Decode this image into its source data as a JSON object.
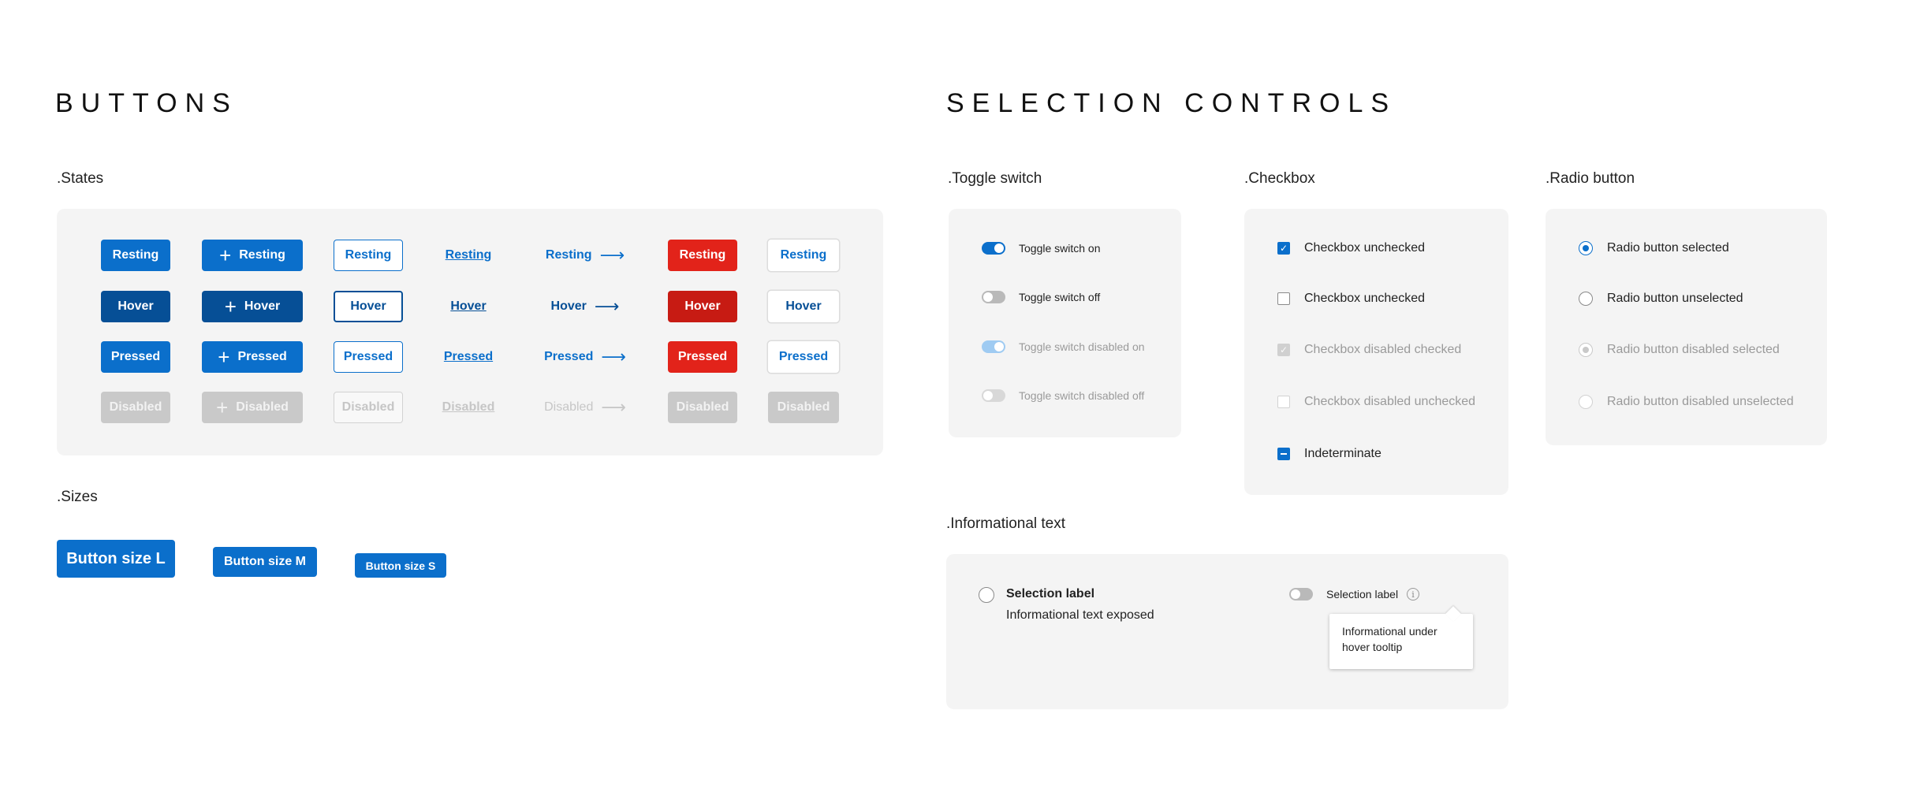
{
  "buttons": {
    "title": "BUTTONS",
    "states_title": ".States",
    "sizes_title": ".Sizes",
    "rows": [
      {
        "primary": "Resting",
        "icon": "Resting",
        "outline": "Resting",
        "link": "Resting",
        "arrow": "Resting",
        "danger": "Resting",
        "ghost": "Resting"
      },
      {
        "primary": "Hover",
        "icon": "Hover",
        "outline": "Hover",
        "link": "Hover",
        "arrow": "Hover",
        "danger": "Hover",
        "ghost": "Hover"
      },
      {
        "primary": "Pressed",
        "icon": "Pressed",
        "outline": "Pressed",
        "link": "Pressed",
        "arrow": "Pressed",
        "danger": "Pressed",
        "ghost": "Pressed"
      },
      {
        "primary": "Disabled",
        "icon": "Disabled",
        "outline": "Disabled",
        "link": "Disabled",
        "arrow": "Disabled",
        "danger": "Disabled",
        "ghost": "Disabled"
      }
    ],
    "sizes": {
      "large": "Button size L",
      "medium": "Button size M",
      "small": "Button size S"
    },
    "icons": {
      "plus": "plus-icon",
      "arrow": "arrow-right-icon"
    }
  },
  "selection": {
    "title": "SELECTION CONTROLS",
    "toggle_title": ".Toggle switch",
    "checkbox_title": ".Checkbox",
    "radio_title": ".Radio button",
    "info_title": ".Informational text",
    "toggles": [
      "Toggle switch on",
      "Toggle switch off",
      "Toggle switch disabled on",
      "Toggle switch disabled off"
    ],
    "checkboxes": [
      "Checkbox unchecked",
      "Checkbox unchecked",
      "Checkbox disabled checked",
      "Checkbox disabled unchecked",
      "Indeterminate"
    ],
    "radios": [
      "Radio button selected",
      "Radio button unselected",
      "Radio button disabled selected",
      "Radio button disabled unselected"
    ],
    "info": {
      "selection_label": "Selection label",
      "exposed_text": "Informational text exposed",
      "toggle_label": "Selection label",
      "tooltip": "Informational under hover tooltip"
    }
  },
  "colors": {
    "primary": "#0b6fcb",
    "primary_hover": "#064f96",
    "danger": "#e2231a",
    "disabled": "#c9c9c9",
    "panel": "#f4f4f4"
  }
}
